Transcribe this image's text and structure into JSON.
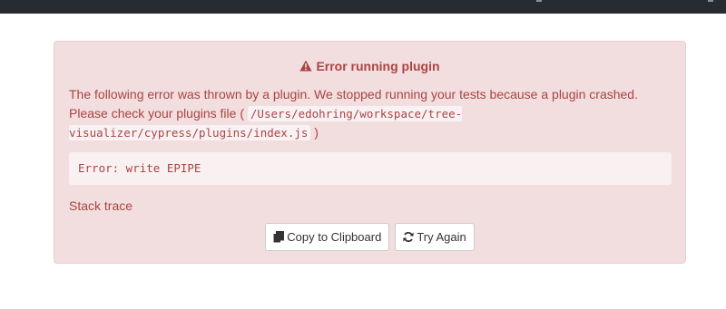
{
  "alert": {
    "title": "Error running plugin",
    "message_text": "The following error was thrown by a plugin. We stopped running your tests because a plugin crashed. Please check your plugins file (",
    "plugins_file_path": "/Users/edohring/workspace/tree-visualizer/cypress/plugins/index.js",
    "message_end": ")",
    "error_text": "Error: write EPIPE",
    "stack_trace_label": "Stack trace",
    "icon": "warning-icon"
  },
  "buttons": {
    "copy_label": "Copy to Clipboard",
    "copy_icon": "clipboard-icon",
    "retry_label": "Try Again",
    "retry_icon": "refresh-icon"
  },
  "colors": {
    "alert_background": "#f2dede",
    "alert_text": "#a94442",
    "top_bar": "#272c33"
  }
}
